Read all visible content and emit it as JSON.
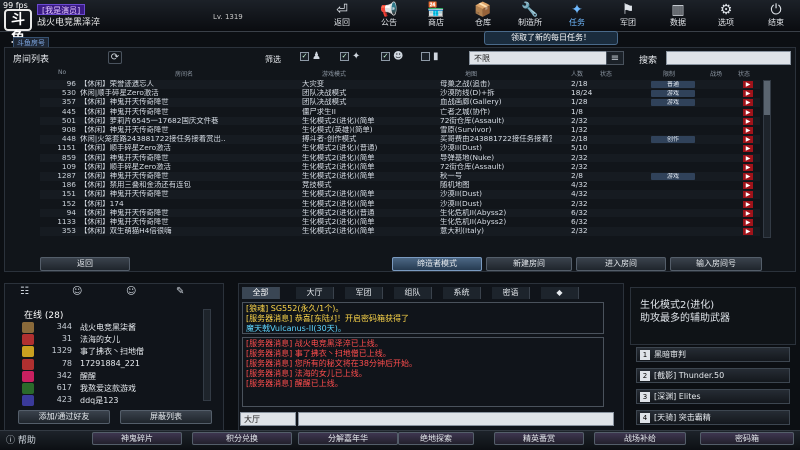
{
  "overlay": {
    "fps": "99 fps"
  },
  "brand": {
    "logo_text": "斗鱼"
  },
  "player": {
    "badge": "[我是演员]",
    "name": "战火电竞黑泽淬",
    "level": "Lv. 1319",
    "room_badge": "斗鱼房号",
    "uid": "10002208"
  },
  "nav": [
    {
      "label": "返回",
      "icon": "⏎"
    },
    {
      "label": "公告",
      "icon": "📢"
    },
    {
      "label": "商店",
      "icon": "🏪"
    },
    {
      "label": "仓库",
      "icon": "📦"
    },
    {
      "label": "制造所",
      "icon": "🔧"
    },
    {
      "label": "任务",
      "icon": "✦"
    },
    {
      "label": "军团",
      "icon": "⚑"
    },
    {
      "label": "数据",
      "icon": "▥"
    },
    {
      "label": "选项",
      "icon": "⚙"
    },
    {
      "label": "结束",
      "icon": "⏻"
    }
  ],
  "notice": "领取了新的每日任务！",
  "room_list": {
    "title": "房间列表",
    "filter_label": "筛选",
    "dropdown_value": "不限",
    "search_label": "搜索",
    "columns": [
      "No",
      "房间名",
      "游戏模式",
      "地图",
      "人数",
      "状态",
      "限制",
      "战场",
      "状态"
    ],
    "rows": [
      {
        "no": "96",
        "name": "【休闲】荣誉迹遗忘人",
        "mode": "大灾变",
        "map": "母巢之战(追击)",
        "players": "2/18",
        "tag": "普通"
      },
      {
        "no": "530",
        "name": "休闲|顺手碎星Zero激活",
        "mode": "团队决战模式",
        "map": "沙漠防线(D)+拆",
        "players": "18/24",
        "tag": "游戏"
      },
      {
        "no": "357",
        "name": "【休闲】神鬼开天传奇降世",
        "mode": "团队决战模式",
        "map": "血战画廊(Gallery)",
        "players": "1/28",
        "tag": "游戏"
      },
      {
        "no": "445",
        "name": "【休闲】神鬼开天传奇降世",
        "mode": "僵尸求生II",
        "map": "亡者之城(协作)",
        "players": "1/8",
        "tag": ""
      },
      {
        "no": "501",
        "name": "【休闲】萝莉片6545一17682国庆文件巷",
        "mode": "生化模式2(进化)(简单",
        "map": "72街仓库(Assault)",
        "players": "2/32",
        "tag": ""
      },
      {
        "no": "908",
        "name": "【休闲】神鬼开天传奇降世",
        "mode": "生化模式(英雄)(简单)",
        "map": "雪原(Survivor)",
        "players": "1/32",
        "tag": ""
      },
      {
        "no": "448",
        "name": "休闲|火笼套路243881722接任务接着赏出..",
        "mode": "搏斗者-创作模式",
        "map": "买哥费由243881722接任务接着赏",
        "players": "2/18",
        "tag": "创作"
      },
      {
        "no": "1151",
        "name": "【休闲】顺手碎星Zero激活",
        "mode": "生化模式2(进化)(普通)",
        "map": "沙漠II(Dust)",
        "players": "5/10",
        "tag": ""
      },
      {
        "no": "859",
        "name": "【休闲】神鬼开天传奇降世",
        "mode": "生化模式2(进化)(简单",
        "map": "导弹基地(Nuke)",
        "players": "2/32",
        "tag": ""
      },
      {
        "no": "109",
        "name": "【休闲】顺手碎星Zero激活",
        "mode": "生化模式2(进化)(简单",
        "map": "72街仓库(Assault)",
        "players": "2/32",
        "tag": ""
      },
      {
        "no": "1287",
        "name": "【休闲】神鬼开天传奇降世",
        "mode": "生化模式2(进化)(简单",
        "map": "秋一号",
        "players": "2/8",
        "tag": "游戏"
      },
      {
        "no": "186",
        "name": "【休闲】禁用三叠和金汤还有连包",
        "mode": "竞技模式",
        "map": "随机地图",
        "players": "4/32",
        "tag": ""
      },
      {
        "no": "151",
        "name": "【休闲】神鬼开天传奇降世",
        "mode": "生化模式2(进化)(简单",
        "map": "沙漠II(Dust)",
        "players": "4/32",
        "tag": ""
      },
      {
        "no": "152",
        "name": "【休闲】174",
        "mode": "生化模式2(进化)(简单",
        "map": "沙漠II(Dust)",
        "players": "2/32",
        "tag": ""
      },
      {
        "no": "94",
        "name": "【休闲】神鬼开天传奇降世",
        "mode": "生化模式2(进化)(普通",
        "map": "生化危机II(Abyss2)",
        "players": "6/32",
        "tag": ""
      },
      {
        "no": "1133",
        "name": "【休闲】神鬼开天传奇降世",
        "mode": "生化模式2(进化)(简单",
        "map": "生化危机II(Abyss2)",
        "players": "6/32",
        "tag": ""
      },
      {
        "no": "353",
        "name": "【休闲】双生萌猫H4倍很嗨",
        "mode": "生化模式2(进化)(简单",
        "map": "意大利(Italy)",
        "players": "2/32",
        "tag": ""
      }
    ],
    "buttons": {
      "return": "返回",
      "spectator": "缔造者模式",
      "new_room": "新建房间",
      "enter_room": "进入房间",
      "enter_room_no": "输入房间号"
    }
  },
  "friends": {
    "online_header": "在线 (28)",
    "list": [
      {
        "num": "344",
        "name": "战火电竞黑柒酱",
        "color": "#8a6a3a"
      },
      {
        "num": "31",
        "name": "法海的女儿",
        "color": "#b03030"
      },
      {
        "num": "1329",
        "name": "事了拂衣丶扫地僧",
        "color": "#c9a020"
      },
      {
        "num": "78",
        "name": "17291884_221",
        "color": "#b03030"
      },
      {
        "num": "342",
        "name": "醒醒",
        "color": "#c92060"
      },
      {
        "num": "617",
        "name": "我熬爱这款游戏",
        "color": "#2a6a2a"
      },
      {
        "num": "423",
        "name": "ddq是123",
        "color": "#3a3a9a"
      }
    ],
    "btn_add": "添加/通过好友",
    "btn_block": "屏蔽列表"
  },
  "chat": {
    "tabs": [
      "全部",
      "大厅",
      "军团",
      "组队",
      "系统",
      "密语"
    ],
    "system_lines": [
      {
        "text": "[狼魂] SG552(永久/1个)。",
        "color": "#ffd84a"
      },
      {
        "text": "[服务器消息] 恭喜[东陆ﾒ]！开启密码箱获得了",
        "color": "#ffd84a"
      },
      {
        "text": "魔天戟Vulcanus-II(30天)。",
        "color": "#5fd7ff"
      }
    ],
    "msg_lines": [
      {
        "text": "[服务器消息] 战火电竞黑泽淬已上线。",
        "color": "#ff4d4d"
      },
      {
        "text": "[服务器消息] 事了拂衣丶扫地僧已上线。",
        "color": "#ff4d4d"
      },
      {
        "text": "[服务器消息] 您所有的秘文将在38分钟后开始。",
        "color": "#ff4d4d"
      },
      {
        "text": "[服务器消息] 法海的女儿已上线。",
        "color": "#ff4d4d"
      },
      {
        "text": "[服务器消息] 醒醒已上线。",
        "color": "#ff4d4d"
      }
    ],
    "channel": "大厅"
  },
  "side": {
    "ad_line1": "生化模式2(进化)",
    "ad_line2": "助攻最多的辅助武器",
    "items": [
      {
        "n": "1",
        "label": "黑暗审判"
      },
      {
        "n": "2",
        "label": "[截影] Thunder.50"
      },
      {
        "n": "3",
        "label": "[深渊] Elites"
      },
      {
        "n": "4",
        "label": "[天骑] 突击霸精"
      }
    ]
  },
  "bottom": {
    "help": "帮助",
    "buttons": [
      "神鬼碎片",
      "积分兑换",
      "分解嘉年华",
      "绝地探索",
      "精英番赏",
      "战场补给",
      "密码箱"
    ]
  }
}
